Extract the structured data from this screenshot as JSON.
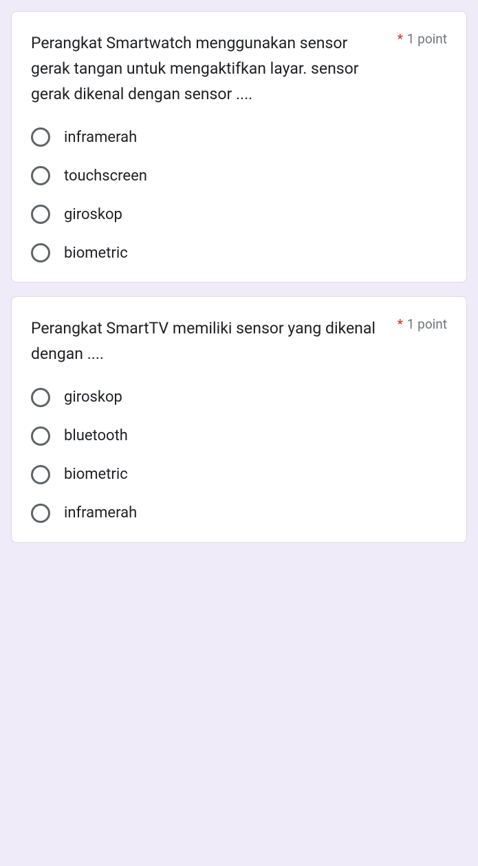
{
  "questions": [
    {
      "text": "Perangkat Smartwatch menggunakan sensor gerak tangan untuk mengaktifkan layar. sensor gerak dikenal dengan sensor ....",
      "required": "*",
      "points": "1 point",
      "options": [
        "inframerah",
        "touchscreen",
        "giroskop",
        "biometric"
      ]
    },
    {
      "text": "Perangkat SmartTV memiliki sensor yang dikenal dengan ....",
      "required": "*",
      "points": "1 point",
      "options": [
        "giroskop",
        "bluetooth",
        "biometric",
        "inframerah"
      ]
    }
  ]
}
